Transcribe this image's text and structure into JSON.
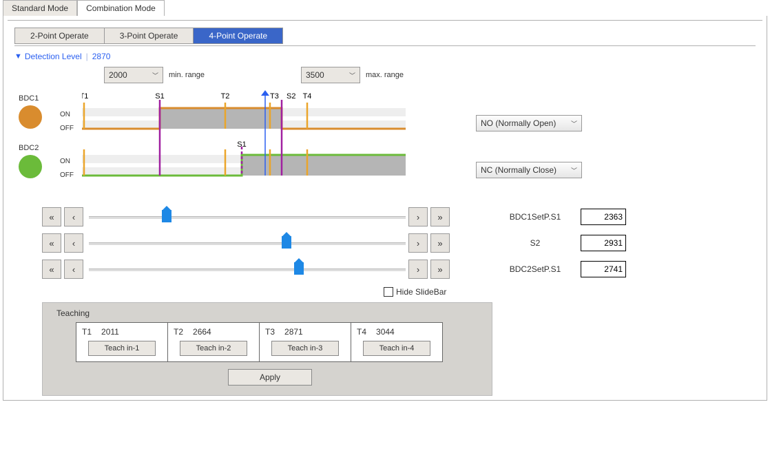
{
  "top_tabs": {
    "standard": "Standard Mode",
    "combination": "Combination Mode"
  },
  "op_tabs": {
    "p2": "2-Point Operate",
    "p3": "3-Point Operate",
    "p4": "4-Point Operate"
  },
  "detection": {
    "label": "Detection Level",
    "value": "2870"
  },
  "range": {
    "min_value": "2000",
    "min_label": "min. range",
    "max_value": "3500",
    "max_label": "max. range"
  },
  "bdc": {
    "bdc1": {
      "name": "BDC1",
      "on": "ON",
      "off": "OFF",
      "color": "#d98c2e",
      "mode": "NO (Normally Open)"
    },
    "bdc2": {
      "name": "BDC2",
      "on": "ON",
      "off": "OFF",
      "color": "#6bbb3a",
      "mode": "NC (Normally Close)"
    }
  },
  "markers": {
    "T1": "T1",
    "T2": "T2",
    "T3": "T3",
    "T4": "T4",
    "S1": "S1",
    "S2": "S2"
  },
  "sliders": {
    "s1": {
      "label": "BDC1SetP.S1",
      "value": "2363"
    },
    "s2": {
      "label": "S2",
      "value": "2931"
    },
    "s3": {
      "label": "BDC2SetP.S1",
      "value": "2741"
    }
  },
  "nav": {
    "dblL": "«",
    "sglL": "‹",
    "sglR": "›",
    "dblR": "»"
  },
  "hide_slidebar": "Hide SlideBar",
  "teaching": {
    "title": "Teaching",
    "cells": [
      {
        "t": "T1",
        "v": "2011",
        "btn": "Teach in-1"
      },
      {
        "t": "T2",
        "v": "2664",
        "btn": "Teach in-2"
      },
      {
        "t": "T3",
        "v": "2871",
        "btn": "Teach in-3"
      },
      {
        "t": "T4",
        "v": "3044",
        "btn": "Teach in-4"
      }
    ],
    "apply": "Apply"
  },
  "chart_data": {
    "type": "timing-diagram",
    "range": [
      2000,
      3500
    ],
    "detection_level": 2870,
    "teaching_points": {
      "T1": 2011,
      "T2": 2664,
      "T3": 2871,
      "T4": 3044
    },
    "set_points": {
      "BDC1_S1": 2363,
      "BDC1_S2": 2931,
      "BDC2_S1": 2741
    },
    "channels": [
      {
        "name": "BDC1",
        "color": "#d98c2e",
        "mode": "NO",
        "on_region": [
          2363,
          2931
        ]
      },
      {
        "name": "BDC2",
        "color": "#6bbb3a",
        "mode": "NC",
        "on_region": [
          2741,
          3500
        ]
      }
    ]
  }
}
